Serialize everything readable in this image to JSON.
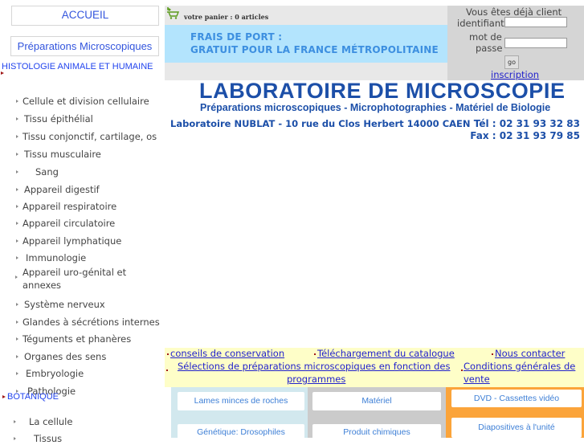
{
  "sidebar": {
    "home_label": "ACCUEIL",
    "section_label": "Préparations Microscopiques",
    "categories": [
      {
        "label": "HISTOLOGIE ANIMALE ET HUMAINE",
        "items": [
          "Cellule et division cellulaire",
          "Tissu épithélial",
          "Tissu conjonctif, cartilage, os",
          "Tissu musculaire",
          "Sang",
          "Appareil digestif",
          "Appareil respiratoire",
          "Appareil circulatoire",
          "Appareil lymphatique",
          "Immunologie",
          "Appareil uro-génital et annexes",
          "Système nerveux",
          "Glandes à sécrétions internes",
          "Téguments et phanères",
          "Organes des sens",
          "Embryologie",
          "Pathologie"
        ]
      },
      {
        "label": "BOTANIQUE",
        "items": [
          "La cellule",
          "Tissus"
        ]
      }
    ]
  },
  "cart": {
    "icon": "cart-icon",
    "text": "votre panier : 0 articles"
  },
  "shipping": {
    "line1": "FRAIS DE PORT :",
    "line2": "GRATUIT POUR LA FRANCE MÉTROPOLITAINE"
  },
  "login": {
    "title": "Vous êtes déjà client",
    "id_label": "identifiant",
    "id_value": "",
    "pw_label_1": "mot de",
    "pw_label_2": "passe",
    "pw_value": "",
    "go_label": "go",
    "register_label": "inscription"
  },
  "header": {
    "title": "LABORATOIRE DE MICROSCOPIE",
    "subtitle": "Préparations microscopiques - Microphotographies - Matériel de Biologie",
    "address": "Laboratoire NUBLAT - 10 rue du Clos Herbert 14000 CAEN",
    "tel": "Tél : 02 31 93 32 83",
    "fax": "Fax : 02 31 93 79 85"
  },
  "links": {
    "conseils": "conseils de conservation",
    "catalogue": "Téléchargement du catalogue",
    "contact": "Nous contacter",
    "selections_1": "Sélections de préparations microscopiques en fonction des",
    "selections_2": "programmes",
    "conditions_1": "Conditions générales de",
    "conditions_2": "vente"
  },
  "categories": {
    "col1": [
      "Lames minces de roches",
      "Génétique: Drosophiles"
    ],
    "col2": [
      "Matériel",
      "Produit chimiques"
    ],
    "col3": [
      "DVD - Cassettes vidéo",
      "Diapositives à l'unité"
    ],
    "colors": {
      "col1": "#d2e8ee",
      "col2": "#cbcbcb",
      "col3": "#fba43a"
    }
  }
}
